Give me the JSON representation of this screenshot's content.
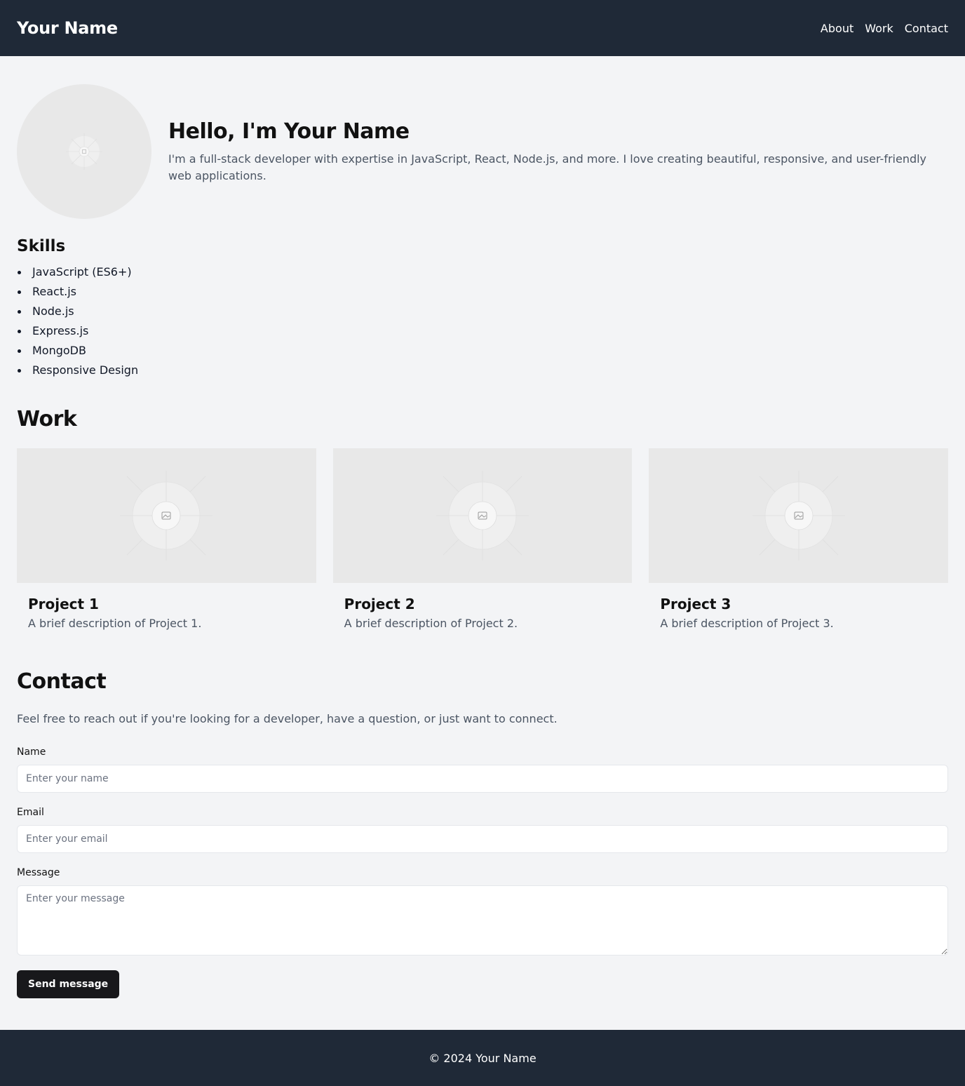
{
  "header": {
    "brand": "Your Name",
    "nav": [
      {
        "label": "About"
      },
      {
        "label": "Work"
      },
      {
        "label": "Contact"
      }
    ]
  },
  "hero": {
    "title": "Hello, I'm Your Name",
    "description": "I'm a full-stack developer with expertise in JavaScript, React, Node.js, and more. I love creating beautiful, responsive, and user-friendly web applications.",
    "avatar_icon": "image-placeholder-icon"
  },
  "skills": {
    "title": "Skills",
    "items": [
      "JavaScript (ES6+)",
      "React.js",
      "Node.js",
      "Express.js",
      "MongoDB",
      "Responsive Design"
    ]
  },
  "work": {
    "title": "Work",
    "projects": [
      {
        "title": "Project 1",
        "description": "A brief description of Project 1.",
        "image_icon": "image-placeholder-icon"
      },
      {
        "title": "Project 2",
        "description": "A brief description of Project 2.",
        "image_icon": "image-placeholder-icon"
      },
      {
        "title": "Project 3",
        "description": "A brief description of Project 3.",
        "image_icon": "image-placeholder-icon"
      }
    ]
  },
  "contact": {
    "title": "Contact",
    "intro": "Feel free to reach out if you're looking for a developer, have a question, or just want to connect.",
    "name_label": "Name",
    "name_placeholder": "Enter your name",
    "email_label": "Email",
    "email_placeholder": "Enter your email",
    "message_label": "Message",
    "message_placeholder": "Enter your message",
    "submit_label": "Send message"
  },
  "footer": {
    "copyright": "© 2024 Your Name"
  },
  "colors": {
    "header_bg": "#1f2937",
    "page_bg": "#f3f4f6",
    "button_bg": "#18181b",
    "placeholder_bg": "#e8e8e8"
  }
}
